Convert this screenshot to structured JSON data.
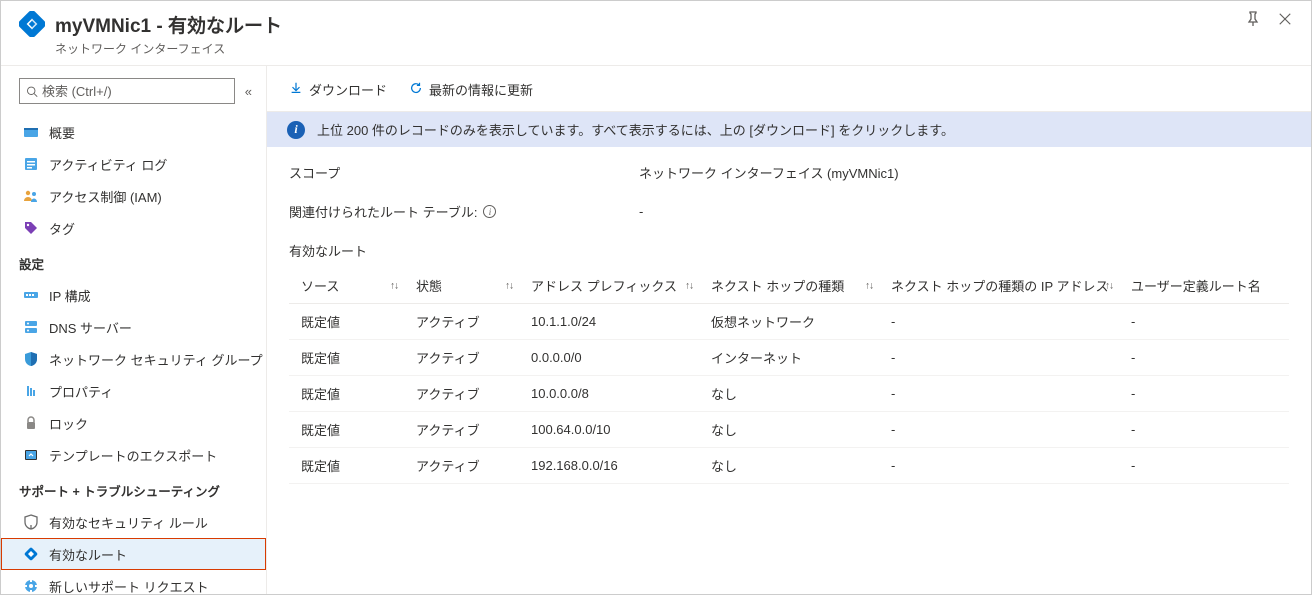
{
  "header": {
    "title": "myVMNic1 - 有効なルート",
    "subtitle": "ネットワーク インターフェイス"
  },
  "sidebar": {
    "search_placeholder": "検索 (Ctrl+/)",
    "top_items": [
      {
        "id": "overview",
        "label": "概要",
        "icon": "overview"
      },
      {
        "id": "activity",
        "label": "アクティビティ ログ",
        "icon": "activity"
      },
      {
        "id": "iam",
        "label": "アクセス制御 (IAM)",
        "icon": "iam"
      },
      {
        "id": "tags",
        "label": "タグ",
        "icon": "tags"
      }
    ],
    "groups": [
      {
        "title": "設定",
        "items": [
          {
            "id": "ipconfig",
            "label": "IP 構成",
            "icon": "ip"
          },
          {
            "id": "dns",
            "label": "DNS サーバー",
            "icon": "dns"
          },
          {
            "id": "nsg",
            "label": "ネットワーク セキュリティ グループ",
            "icon": "nsg"
          },
          {
            "id": "props",
            "label": "プロパティ",
            "icon": "props"
          },
          {
            "id": "lock",
            "label": "ロック",
            "icon": "lock"
          },
          {
            "id": "export",
            "label": "テンプレートのエクスポート",
            "icon": "export"
          }
        ]
      },
      {
        "title": "サポート + トラブルシューティング",
        "items": [
          {
            "id": "effsec",
            "label": "有効なセキュリティ ルール",
            "icon": "effsec"
          },
          {
            "id": "effroute",
            "label": "有効なルート",
            "icon": "effroute",
            "selected": true
          },
          {
            "id": "support",
            "label": "新しいサポート リクエスト",
            "icon": "support"
          }
        ]
      }
    ]
  },
  "toolbar": {
    "download_label": "ダウンロード",
    "refresh_label": "最新の情報に更新"
  },
  "info_message": "上位 200 件のレコードのみを表示しています。すべて表示するには、上の [ダウンロード] をクリックします。",
  "detail": {
    "scope_label": "スコープ",
    "scope_value": "ネットワーク インターフェイス (myVMNic1)",
    "route_table_label": "関連付けられたルート テーブル:",
    "route_table_value": "-",
    "table_title": "有効なルート"
  },
  "table": {
    "columns": [
      "ソース",
      "状態",
      "アドレス プレフィックス",
      "ネクスト ホップの種類",
      "ネクスト ホップの種類の IP アドレス",
      "ユーザー定義ルート名"
    ],
    "rows": [
      {
        "src": "既定値",
        "state": "アクティブ",
        "prefix": "10.1.1.0/24",
        "hop": "仮想ネットワーク",
        "ip": "-",
        "user": "-"
      },
      {
        "src": "既定値",
        "state": "アクティブ",
        "prefix": "0.0.0.0/0",
        "hop": "インターネット",
        "ip": "-",
        "user": "-"
      },
      {
        "src": "既定値",
        "state": "アクティブ",
        "prefix": "10.0.0.0/8",
        "hop": "なし",
        "ip": "-",
        "user": "-"
      },
      {
        "src": "既定値",
        "state": "アクティブ",
        "prefix": "100.64.0.0/10",
        "hop": "なし",
        "ip": "-",
        "user": "-"
      },
      {
        "src": "既定値",
        "state": "アクティブ",
        "prefix": "192.168.0.0/16",
        "hop": "なし",
        "ip": "-",
        "user": "-"
      }
    ]
  }
}
